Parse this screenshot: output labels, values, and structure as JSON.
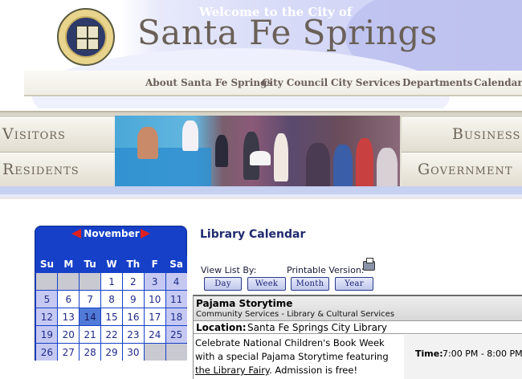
{
  "header": {
    "welcome": "Welcome to the City of",
    "city_name": "Santa Fe Springs"
  },
  "topnav": {
    "items": [
      {
        "label": "About Santa Fe Springs"
      },
      {
        "label": "City Council"
      },
      {
        "label": "City Services"
      },
      {
        "label": "Departments"
      },
      {
        "label": "Calendar"
      }
    ]
  },
  "banner": {
    "visitors": "Visitors",
    "residents": "Residents",
    "business": "Business",
    "government": "Government"
  },
  "calendar": {
    "month": "November",
    "weekdays": [
      "Su",
      "M",
      "Tu",
      "W",
      "Th",
      "F",
      "Sa"
    ],
    "weeks": [
      [
        "",
        "",
        "",
        "1",
        "2",
        "3",
        "4"
      ],
      [
        "5",
        "6",
        "7",
        "8",
        "9",
        "10",
        "11"
      ],
      [
        "12",
        "13",
        "14",
        "15",
        "16",
        "17",
        "18"
      ],
      [
        "19",
        "20",
        "21",
        "22",
        "23",
        "24",
        "25"
      ],
      [
        "26",
        "27",
        "28",
        "29",
        "30",
        "",
        ""
      ]
    ],
    "today": "14"
  },
  "library": {
    "title": "Library Calendar",
    "view_list_label": "View List By:",
    "printable_label": "Printable Version:",
    "view_buttons": [
      {
        "label": "Day"
      },
      {
        "label": "Week"
      },
      {
        "label": "Month"
      },
      {
        "label": "Year"
      }
    ]
  },
  "event": {
    "title": "Pajama Storytime",
    "department": "Community Services - Library & Cultural Services",
    "location_label": "Location:",
    "location_value": "Santa Fe Springs City Library",
    "description_pre": "Celebrate National Children's Book Week with a special Pajama Storytime featuring ",
    "description_link": "the Library Fairy",
    "description_post": ". Admission is free!",
    "time_label": "Time:",
    "time_value": "7:00 PM - 8:00 PM"
  }
}
